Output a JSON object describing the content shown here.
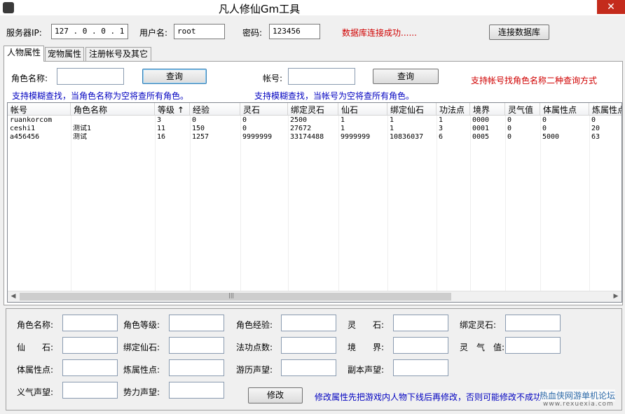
{
  "window": {
    "title": "凡人修仙Gm工具",
    "close_glyph": "✕"
  },
  "connection": {
    "server_label": "服务器IP:",
    "server_value": "127 . 0  . 0 . 1",
    "user_label": "用户名:",
    "user_value": "root",
    "password_label": "密码:",
    "password_value": "123456",
    "status": "数据库连接成功......",
    "connect_button": "连接数据库"
  },
  "tabs": [
    {
      "label": "人物属性",
      "active": true
    },
    {
      "label": "宠物属性",
      "active": false
    },
    {
      "label": "注册帐号及其它",
      "active": false
    }
  ],
  "search": {
    "role_label": "角色名称:",
    "role_value": "",
    "role_query_button": "查询",
    "account_label": "帐号:",
    "account_value": "",
    "account_query_button": "查询",
    "tip_right": "支持帐号找角色名称二种查询方式",
    "fuzzy_role_tip": "支持模糊查找，当角色名称为空将查所有角色。",
    "fuzzy_account_tip": "支持模糊查找，当帐号为空将查所有角色。"
  },
  "table": {
    "columns": [
      "帐号",
      "角色名称",
      "等级 ↑",
      "经验",
      "灵石",
      "绑定灵石",
      "仙石",
      "绑定仙石",
      "功法点",
      "境界",
      "灵气值",
      "体属性点",
      "炼属性点"
    ],
    "rows": [
      [
        "ruankorcom",
        "",
        "3",
        "0",
        "0",
        "2500",
        "1",
        "1",
        "1",
        "0000",
        "0",
        "0",
        "0"
      ],
      [
        "ceshi1",
        "测试1",
        "11",
        "150",
        "0",
        "27672",
        "1",
        "1",
        "3",
        "0001",
        "0",
        "0",
        "20"
      ],
      [
        "a456456",
        "测试",
        "16",
        "1257",
        "9999999",
        "33174488",
        "9999999",
        "10836037",
        "6",
        "0005",
        "0",
        "5000",
        "63"
      ]
    ],
    "scroll_left": "◀",
    "scroll_right": "▶",
    "scroll_grip": "|||"
  },
  "edit": {
    "fields": [
      {
        "label": "角色名称:",
        "value": ""
      },
      {
        "label": "角色等级:",
        "value": ""
      },
      {
        "label": "角色经验:",
        "value": ""
      },
      {
        "label": "灵　　石:",
        "value": ""
      },
      {
        "label": "绑定灵石:",
        "value": ""
      },
      {
        "label": "仙　　石:",
        "value": ""
      },
      {
        "label": "绑定仙石:",
        "value": ""
      },
      {
        "label": "法功点数:",
        "value": ""
      },
      {
        "label": "境　　界:",
        "value": ""
      },
      {
        "label": "灵　气　值:",
        "value": ""
      },
      {
        "label": "体属性点:",
        "value": ""
      },
      {
        "label": "炼属性点:",
        "value": ""
      },
      {
        "label": "游历声望:",
        "value": ""
      },
      {
        "label": "副本声望:",
        "value": ""
      },
      {
        "label": "义气声望:",
        "value": ""
      },
      {
        "label": "势力声望:",
        "value": ""
      }
    ],
    "modify_button": "修改",
    "warning": "修改属性先把游戏内人物下线后再修改，否则可能修改不成功"
  },
  "watermark": {
    "text": "热血侠网游单机论坛",
    "url": "www.rexuexia.com"
  },
  "colors": {
    "status_red": "#d00000",
    "tip_blue": "#0000c0",
    "close_red": "#c42b1c"
  }
}
